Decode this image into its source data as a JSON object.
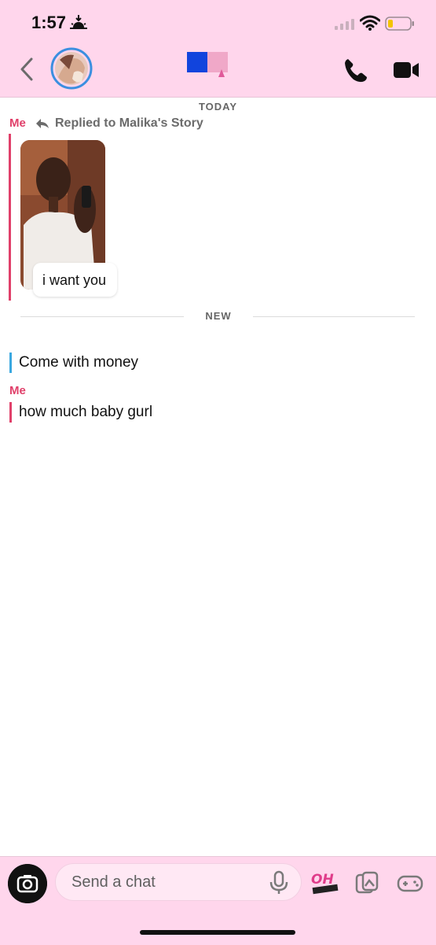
{
  "status_bar": {
    "time": "1:57"
  },
  "header": {
    "back_icon": "chevron-left-icon",
    "call_icon": "phone-icon",
    "video_icon": "video-camera-icon",
    "badge_colors": [
      "#1144dd",
      "#f0a8c8"
    ],
    "accent": "#ffd6ec"
  },
  "chat": {
    "date_label": "TODAY",
    "new_label": "NEW",
    "messages": [
      {
        "sender": "Me",
        "reply_label": "Replied to Malika's Story",
        "story_caption": "i want you",
        "bar_color": "#e0406a"
      },
      {
        "sender": "",
        "text": "Come with money",
        "bar_color": "#3aa8e0"
      },
      {
        "sender": "Me",
        "text": "how much baby gurl",
        "bar_color": "#e0406a"
      }
    ]
  },
  "composer": {
    "placeholder": "Send a chat",
    "sticker_text": "OH",
    "camera_icon": "camera-icon",
    "mic_icon": "microphone-icon",
    "memories_icon": "memories-icon",
    "games_icon": "gamepad-icon"
  }
}
